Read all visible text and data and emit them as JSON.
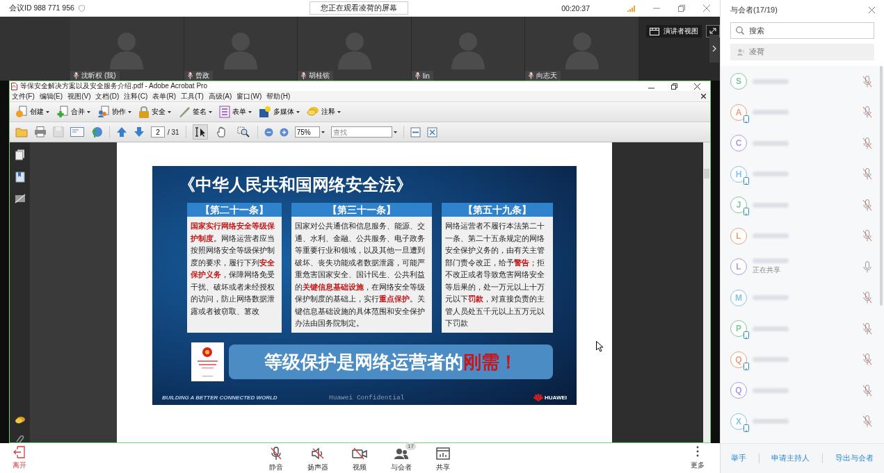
{
  "top_bar": {
    "meeting_id": "会议ID 988 771 956",
    "viewing_notice": "您正在观看凌荷的屏幕",
    "elapsed": "00:20:37"
  },
  "video_tiles": [
    {
      "name": "沈昕权 (我)"
    },
    {
      "name": "曾政"
    },
    {
      "name": "胡桂镔"
    },
    {
      "name": "lin"
    },
    {
      "name": "向志天"
    }
  ],
  "presenter_view_button": "演讲者视图",
  "shared_window": {
    "title": "等保安全解决方案以及安全服务介绍.pdf - Adobe Acrobat Pro",
    "menu": [
      "文件(F)",
      "编辑(E)",
      "视图(V)",
      "文档(D)",
      "注释(C)",
      "表单(R)",
      "工具(T)",
      "高级(A)",
      "窗口(W)",
      "帮助(H)"
    ],
    "task_buttons": [
      {
        "kind": "create",
        "label": "创建"
      },
      {
        "kind": "combine",
        "label": "合并"
      },
      {
        "kind": "collaborate",
        "label": "协作"
      },
      {
        "kind": "secure",
        "label": "安全"
      },
      {
        "kind": "sign",
        "label": "签名"
      },
      {
        "kind": "forms",
        "label": "表单"
      },
      {
        "kind": "multimedia",
        "label": "多媒体"
      },
      {
        "kind": "comment",
        "label": "注释"
      }
    ],
    "tools": [
      {
        "kind": "select",
        "selected": true
      },
      {
        "kind": "hand",
        "selected": false
      },
      {
        "kind": "zoom",
        "selected": false
      }
    ],
    "page_number": "2",
    "page_total": "/ 31",
    "zoom": "75%",
    "find_placeholder": "查找",
    "slide": {
      "title": "《中华人民共和国网络安全法》",
      "articles": [
        {
          "heading": "【第二十一条】",
          "body": "**国家实行网络安全等级保护制度**。网络运营者应当按照网络安全等级保护制度的要求，履行下列**安全保护义务**，保障网络免受干扰、破坏或者未经授权的访问，防止网络数据泄露或者被窃取、篡改"
        },
        {
          "heading": "【第三十一条】",
          "body": "国家对公共通信和信息服务、能源、交通、水利、金融、公共服务、电子政务等重要行业和领域，以及其他一旦遭到破坏、丧失功能或者数据泄露，可能严重危害国家安全、国计民生、公共利益的**关键信息基础设施**，在网络安全等级保护制度的基础上，实行**重点保护**。关键信息基础设施的具体范围和安全保护办法由国务院制定。"
        },
        {
          "heading": "【第五十九条】",
          "body": "网络运营者不履行本法第二十一条、第二十五条规定的网络安全保护义务的，由有关主管部门责令改正，给予**警告**；拒不改正或者导致危害网络安全等后果的，处一万元以上十万元以下**罚款**，对直接负责的主管人员处五千元以上五万元以下罚款"
        }
      ],
      "banner": "等级保护是网络运营者的**刚需！**",
      "slogan": "BUILDING A BETTER CONNECTED WORLD",
      "confidential": "Huawei Confidential",
      "brand": "HUAWEI"
    }
  },
  "participants": {
    "title": "与会者(17/19)",
    "search_placeholder": "搜索",
    "presenter": "凌荷",
    "items": [
      {
        "initial": "S",
        "color": "#7fc79b",
        "mobile": false,
        "muted": true
      },
      {
        "initial": "A",
        "color": "#e9a07c",
        "mobile": true,
        "muted": true
      },
      {
        "initial": "C",
        "color": "#a79ce6",
        "mobile": false,
        "muted": true
      },
      {
        "initial": "H",
        "color": "#86c4e6",
        "mobile": true,
        "muted": true
      },
      {
        "initial": "J",
        "color": "#7fc79b",
        "mobile": true,
        "muted": true
      },
      {
        "initial": "L",
        "color": "#e9a07c",
        "mobile": false,
        "muted": true
      },
      {
        "initial": "L",
        "color": "#a79ce6",
        "mobile": false,
        "muted": false,
        "status": "正在共享"
      },
      {
        "initial": "M",
        "color": "#86c4e6",
        "mobile": false,
        "muted": true
      },
      {
        "initial": "P",
        "color": "#7fc79b",
        "mobile": true,
        "muted": true
      },
      {
        "initial": "Q",
        "color": "#e9a07c",
        "mobile": true,
        "muted": true
      },
      {
        "initial": "Q",
        "color": "#a79ce6",
        "mobile": false,
        "muted": true
      },
      {
        "initial": "X",
        "color": "#86c4e6",
        "mobile": true,
        "muted": true
      }
    ],
    "actions": [
      "举手",
      "申请主持人",
      "导出与会者"
    ]
  },
  "bottom_bar": {
    "leave": "离开",
    "controls": [
      {
        "kind": "mic",
        "label": "静音",
        "off": true
      },
      {
        "kind": "speaker",
        "label": "扬声器",
        "off": true
      },
      {
        "kind": "video",
        "label": "视频",
        "off": true
      },
      {
        "kind": "participants",
        "label": "与会者",
        "badge": "17"
      },
      {
        "kind": "share",
        "label": "共享"
      }
    ],
    "more": "更多"
  }
}
